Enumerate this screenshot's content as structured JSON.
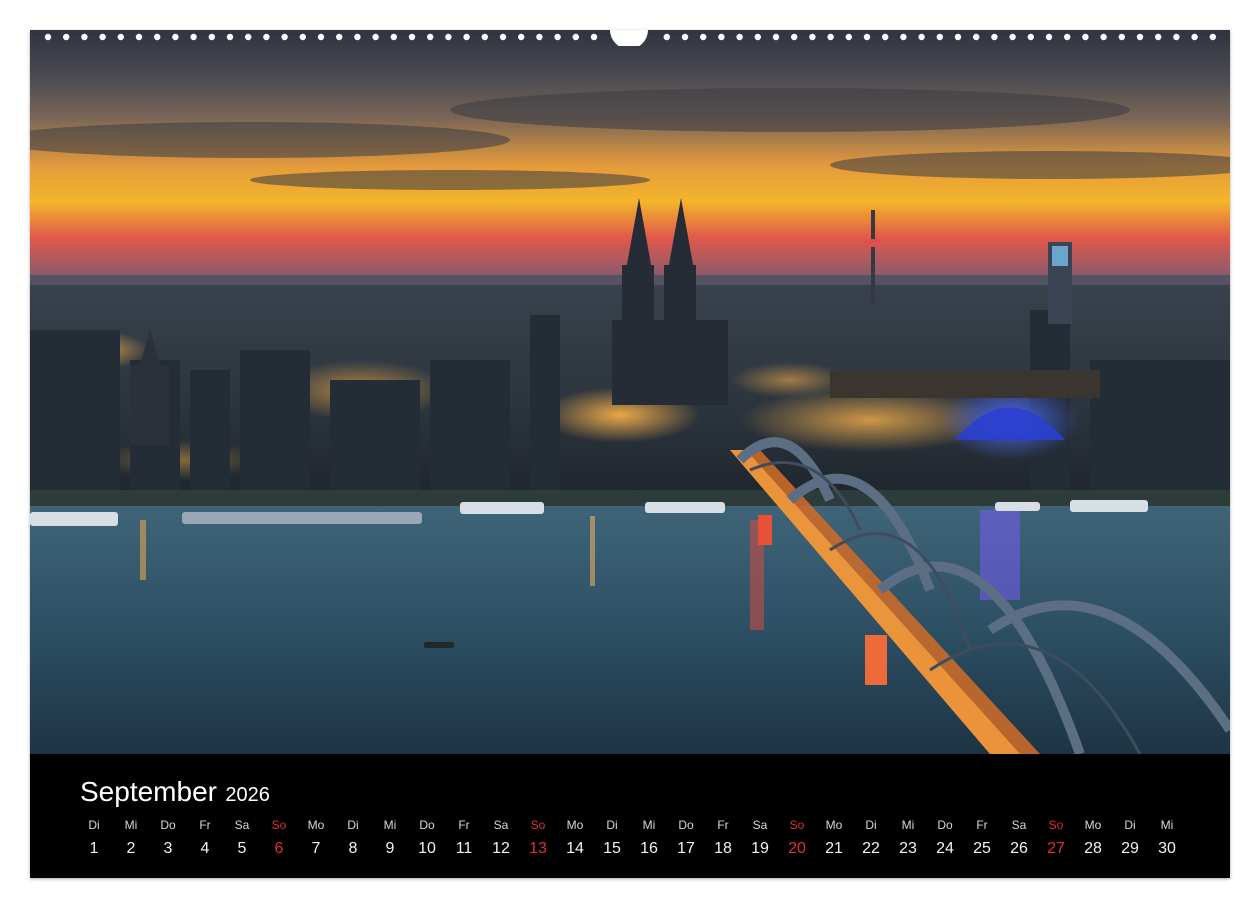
{
  "calendar": {
    "month": "September",
    "year": "2026",
    "days": [
      {
        "name": "Di",
        "num": "1",
        "sunday": false
      },
      {
        "name": "Mi",
        "num": "2",
        "sunday": false
      },
      {
        "name": "Do",
        "num": "3",
        "sunday": false
      },
      {
        "name": "Fr",
        "num": "4",
        "sunday": false
      },
      {
        "name": "Sa",
        "num": "5",
        "sunday": false
      },
      {
        "name": "So",
        "num": "6",
        "sunday": true
      },
      {
        "name": "Mo",
        "num": "7",
        "sunday": false
      },
      {
        "name": "Di",
        "num": "8",
        "sunday": false
      },
      {
        "name": "Mi",
        "num": "9",
        "sunday": false
      },
      {
        "name": "Do",
        "num": "10",
        "sunday": false
      },
      {
        "name": "Fr",
        "num": "11",
        "sunday": false
      },
      {
        "name": "Sa",
        "num": "12",
        "sunday": false
      },
      {
        "name": "So",
        "num": "13",
        "sunday": true
      },
      {
        "name": "Mo",
        "num": "14",
        "sunday": false
      },
      {
        "name": "Di",
        "num": "15",
        "sunday": false
      },
      {
        "name": "Mi",
        "num": "16",
        "sunday": false
      },
      {
        "name": "Do",
        "num": "17",
        "sunday": false
      },
      {
        "name": "Fr",
        "num": "18",
        "sunday": false
      },
      {
        "name": "Sa",
        "num": "19",
        "sunday": false
      },
      {
        "name": "So",
        "num": "20",
        "sunday": true
      },
      {
        "name": "Mo",
        "num": "21",
        "sunday": false
      },
      {
        "name": "Di",
        "num": "22",
        "sunday": false
      },
      {
        "name": "Mi",
        "num": "23",
        "sunday": false
      },
      {
        "name": "Do",
        "num": "24",
        "sunday": false
      },
      {
        "name": "Fr",
        "num": "25",
        "sunday": false
      },
      {
        "name": "Sa",
        "num": "26",
        "sunday": false
      },
      {
        "name": "So",
        "num": "27",
        "sunday": true
      },
      {
        "name": "Mo",
        "num": "28",
        "sunday": false
      },
      {
        "name": "Di",
        "num": "29",
        "sunday": false
      },
      {
        "name": "Mi",
        "num": "30",
        "sunday": false
      }
    ]
  },
  "colors": {
    "sunday": "#e03030",
    "background": "#000000",
    "text": "#ffffff"
  },
  "photo": {
    "icon": "cologne-cathedral-skyline-photo"
  }
}
